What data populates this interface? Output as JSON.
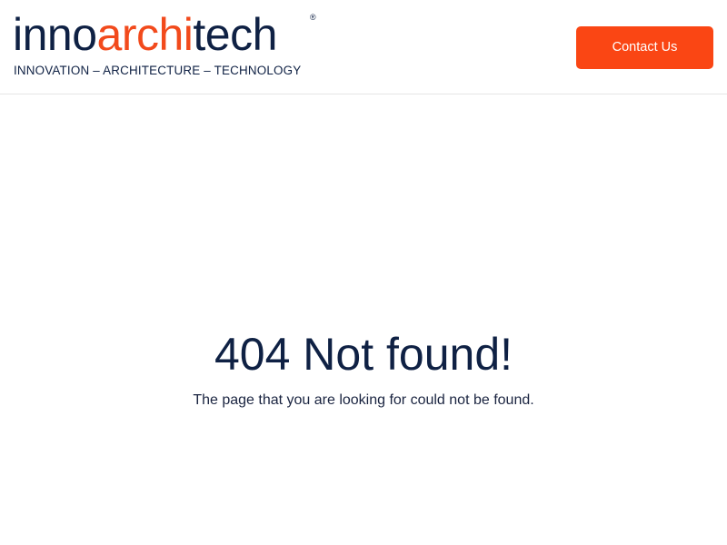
{
  "header": {
    "logo": {
      "part1": "inno",
      "part2": "archi",
      "part3": "tech",
      "registered_mark": "®",
      "tagline": "INNOVATION – ARCHITECTURE – TECHNOLOGY"
    },
    "contact_button_label": "Contact Us"
  },
  "main": {
    "title": "404 Not found!",
    "message": "The page that you are looking for could not be found."
  },
  "colors": {
    "brand_navy": "#0f2144",
    "brand_orange": "#f24a1c",
    "button_bg": "#fa4614"
  }
}
